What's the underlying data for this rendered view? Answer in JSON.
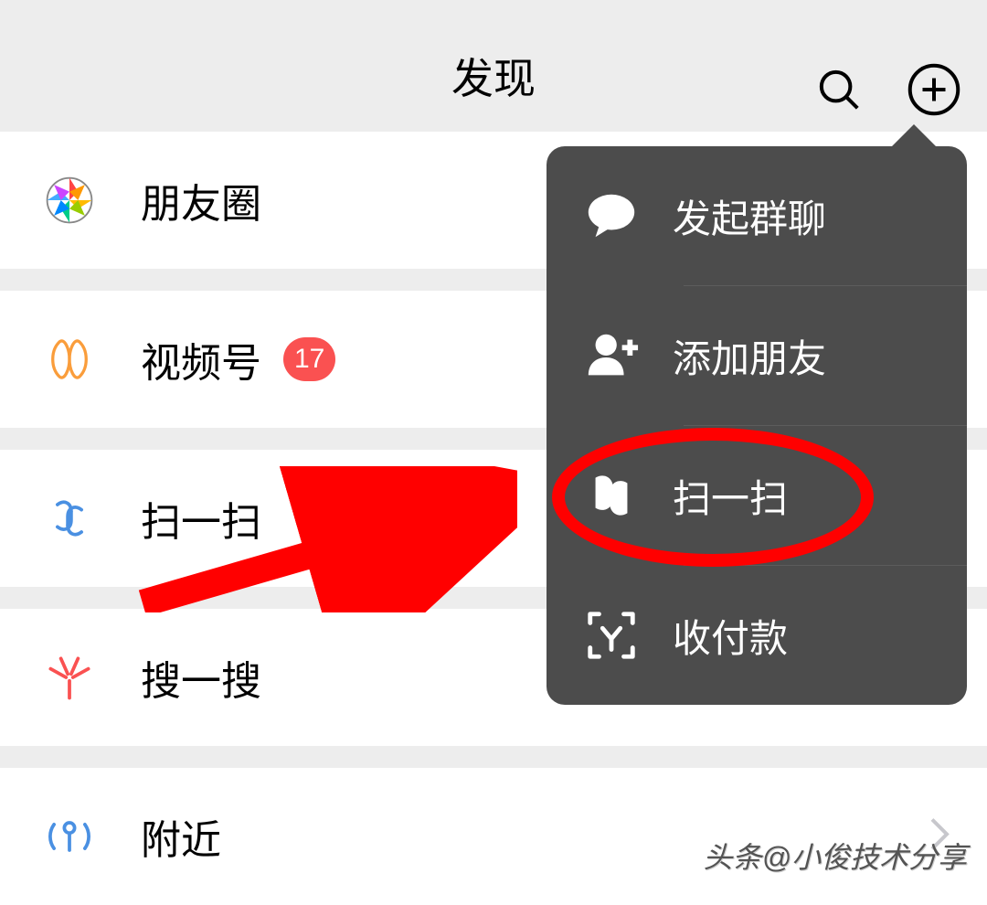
{
  "header": {
    "title": "发现"
  },
  "rows": {
    "moments": {
      "label": "朋友圈"
    },
    "channels": {
      "label": "视频号",
      "badge": "17"
    },
    "scan": {
      "label": "扫一扫"
    },
    "search": {
      "label": "搜一搜"
    },
    "nearby": {
      "label": "附近"
    }
  },
  "popover": {
    "group_chat": {
      "label": "发起群聊"
    },
    "add_friends": {
      "label": "添加朋友"
    },
    "scan": {
      "label": "扫一扫"
    },
    "money": {
      "label": "收付款"
    }
  },
  "watermark": "头条@小俊技术分享"
}
